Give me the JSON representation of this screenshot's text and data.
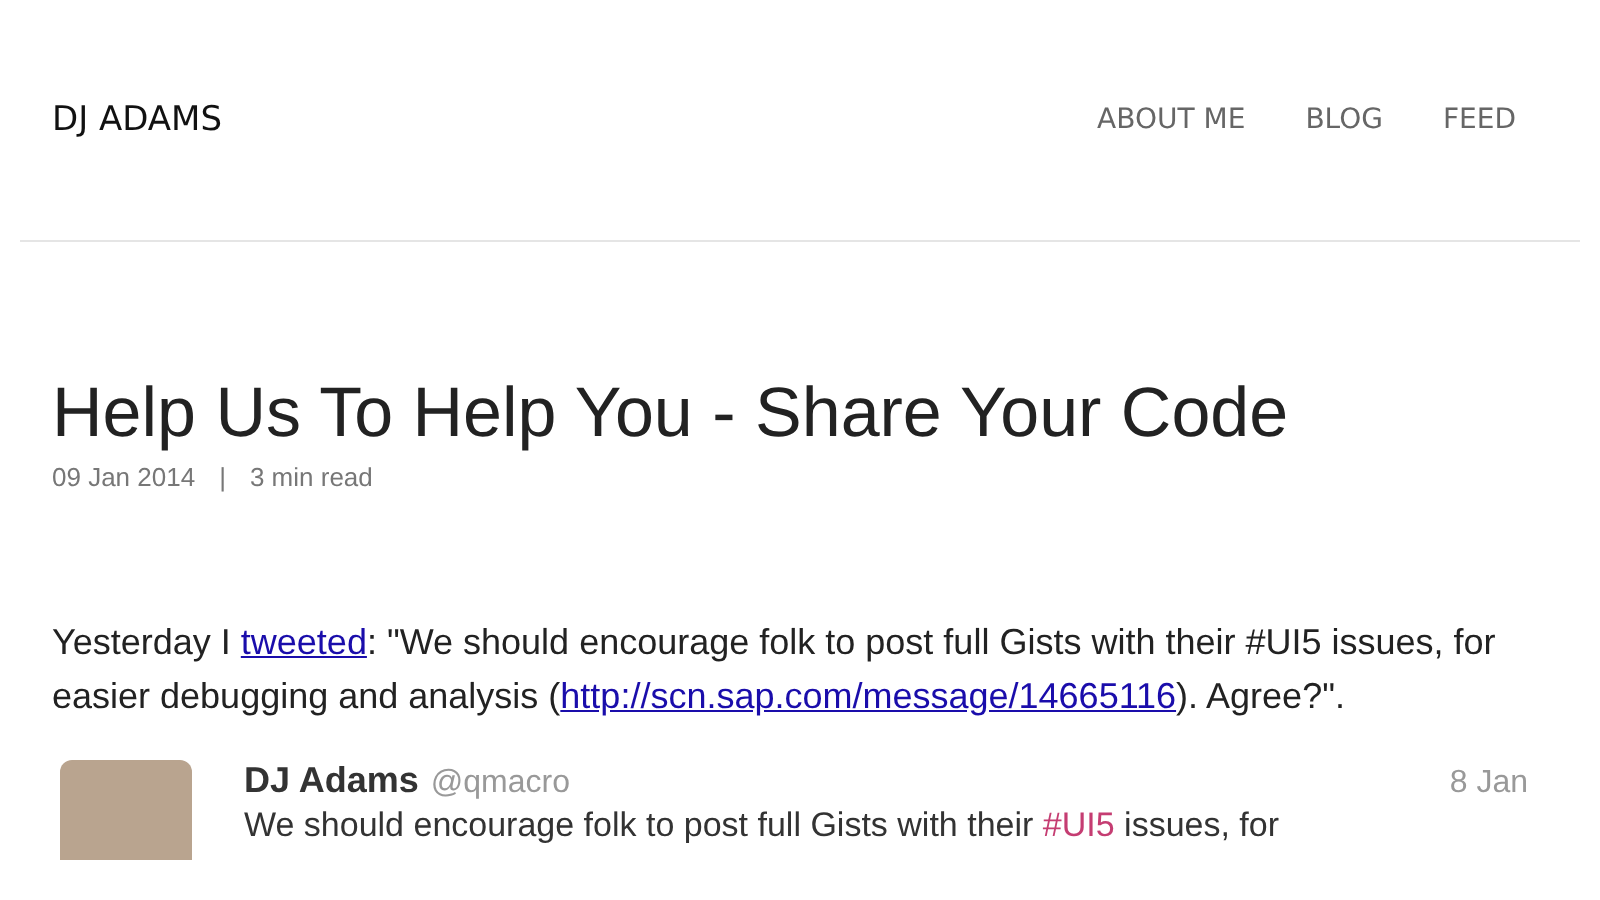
{
  "site_title": "DJ ADAMS",
  "nav": [
    {
      "label": "ABOUT ME"
    },
    {
      "label": "BLOG"
    },
    {
      "label": "FEED"
    }
  ],
  "post": {
    "title": "Help Us To Help You - Share Your Code",
    "date": "09 Jan 2014",
    "separator": "|",
    "read_time": "3 min read",
    "paragraph": [
      {
        "kind": "text",
        "text": "Yesterday I "
      },
      {
        "kind": "link",
        "text": "tweeted"
      },
      {
        "kind": "text",
        "text": ": \"We should encourage folk to post full Gists with their #UI5 issues, for easier debugging and analysis ("
      },
      {
        "kind": "link",
        "text": "http://scn.sap.com/message/14665116"
      },
      {
        "kind": "text",
        "text": "). Agree?\"."
      }
    ]
  },
  "tweet": {
    "name": "DJ Adams",
    "handle": "@qmacro",
    "date": "8 Jan",
    "text": [
      {
        "kind": "text",
        "text": "We should encourage folk to post full Gists with their "
      },
      {
        "kind": "hashtag",
        "text": "#UI5"
      },
      {
        "kind": "text",
        "text": " issues, for"
      }
    ]
  }
}
